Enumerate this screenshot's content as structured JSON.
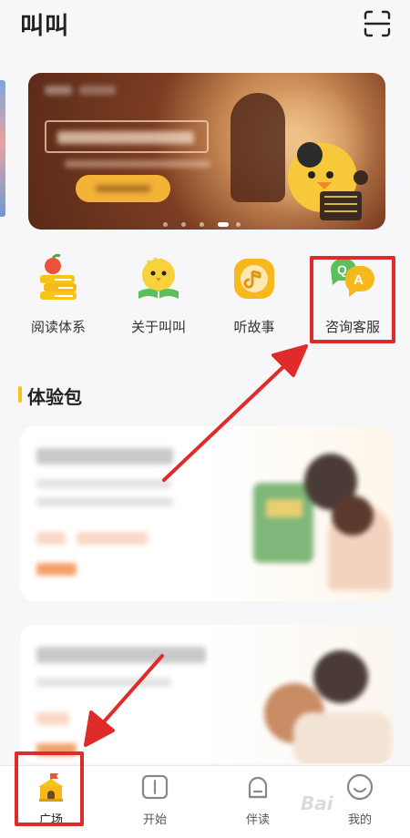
{
  "header": {
    "title": "叫叫"
  },
  "quick_nav": [
    {
      "label": "阅读体系"
    },
    {
      "label": "关于叫叫"
    },
    {
      "label": "听故事"
    },
    {
      "label": "咨询客服"
    }
  ],
  "section": {
    "title": "体验包"
  },
  "tabbar": {
    "items": [
      {
        "label": "广场",
        "active": true
      },
      {
        "label": "开始",
        "active": false
      },
      {
        "label": "伴读",
        "active": false
      },
      {
        "label": "我的",
        "active": false
      }
    ]
  },
  "watermark": "Bai",
  "colors": {
    "accent": "#f5c518",
    "highlight": "#e02b2b",
    "banner_button": "#f3b336"
  }
}
